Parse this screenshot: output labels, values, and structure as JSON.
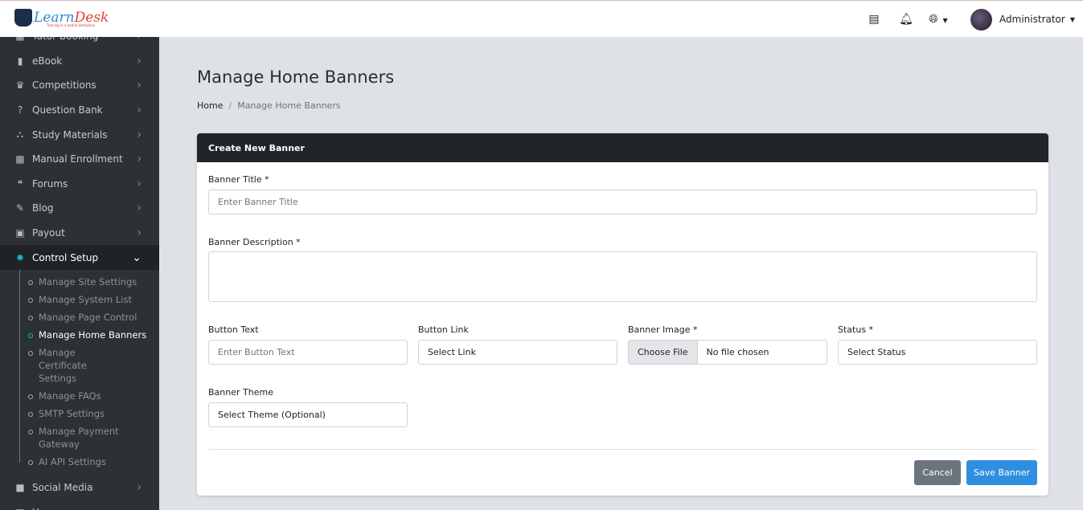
{
  "brand": {
    "name_part1": "Learn",
    "name_part2": "Desk",
    "tagline": "Training in a hybrid workplace"
  },
  "topbar": {
    "user": "Administrator"
  },
  "sidebar": {
    "items_top": [
      {
        "label": "Tutor Booking",
        "icon": "calendar-icon"
      },
      {
        "label": "eBook",
        "icon": "book-icon"
      },
      {
        "label": "Competitions",
        "icon": "trophy-icon"
      },
      {
        "label": "Question Bank",
        "icon": "question-icon"
      },
      {
        "label": "Study Materials",
        "icon": "sitemap-icon"
      },
      {
        "label": "Manual Enrollment",
        "icon": "grid-icon"
      },
      {
        "label": "Forums",
        "icon": "comments-icon"
      },
      {
        "label": "Blog",
        "icon": "blog-icon"
      },
      {
        "label": "Payout",
        "icon": "money-icon"
      }
    ],
    "active": {
      "label": "Control Setup"
    },
    "subitems": [
      "Manage Site Settings",
      "Manage System List",
      "Manage Page Control",
      "Manage Home Banners",
      "Manage Certificate Settings",
      "Manage FAQs",
      "SMTP Settings",
      "Manage Payment Gateway",
      "AI API Settings"
    ],
    "items_bottom": [
      {
        "label": "Social Media"
      },
      {
        "label": "Users:"
      }
    ]
  },
  "page": {
    "title": "Manage Home Banners",
    "breadcrumb": [
      "Home",
      "Manage Home Banners"
    ]
  },
  "form": {
    "header": "Create New Banner",
    "title_label": "Banner Title *",
    "title_placeholder": "Enter Banner Title",
    "desc_label": "Banner Description *",
    "btntext_label": "Button Text",
    "btntext_placeholder": "Enter Button Text",
    "link_label": "Button Link",
    "link_value": "Select Link",
    "image_label": "Banner Image *",
    "choose_file": "Choose File",
    "no_file": "No file chosen",
    "status_label": "Status *",
    "status_value": "Select Status",
    "theme_label": "Banner Theme",
    "theme_value": "Select Theme (Optional)",
    "cancel": "Cancel",
    "save": "Save Banner"
  },
  "colors": {
    "accent": "#2e8fe0",
    "cancel": "#6c757d",
    "sidebar": "#2c3136"
  }
}
